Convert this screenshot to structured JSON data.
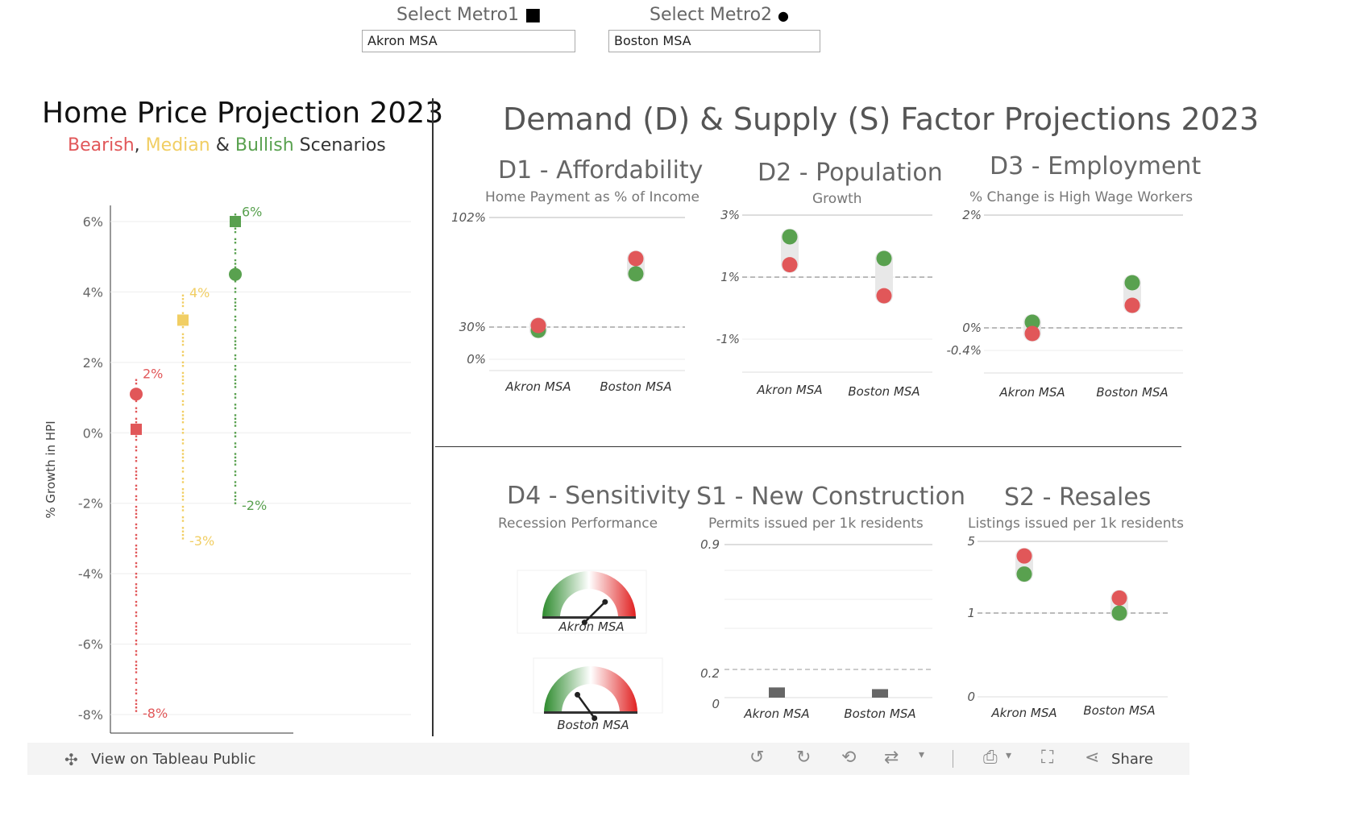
{
  "filters": {
    "metro1": {
      "label": "Select Metro1",
      "symbol": "■",
      "value": "Akron MSA"
    },
    "metro2": {
      "label": "Select Metro2",
      "symbol": "●",
      "value": "Boston MSA"
    }
  },
  "left": {
    "title": "Home Price Projection 2023",
    "subtitle": {
      "bearish": "Bearish",
      "comma": ",",
      "median": "Median",
      "amp": "&",
      "bullish": "Bullish",
      "rest": "Scenarios"
    }
  },
  "right": {
    "title": "Demand (D) & Supply (S) Factor Projections 2023"
  },
  "colors": {
    "red": "#e15759",
    "yellow": "#f1ce63",
    "green": "#59a14f",
    "grey": "#666666"
  },
  "chart_data": [
    {
      "id": "hpi",
      "type": "scatter",
      "title": "Home Price Projection 2023",
      "ylabel": "% Growth in HPI",
      "ylim": [
        -8.5,
        6.3
      ],
      "yticks": [
        "6%",
        "4%",
        "2%",
        "0%",
        "-2%",
        "-4%",
        "-6%",
        "-8%"
      ],
      "ytick_values": [
        6,
        4,
        2,
        0,
        -2,
        -4,
        -6,
        -8
      ],
      "series": [
        {
          "name": "Bearish",
          "color": "#e15759",
          "range": [
            -8,
            1.6
          ],
          "range_labels": [
            "2%",
            "-8%"
          ],
          "metro1_square": 0.1,
          "metro2_circle": 1.1
        },
        {
          "name": "Median",
          "color": "#f1ce63",
          "range": [
            -3.1,
            3.9
          ],
          "range_labels": [
            "4%",
            "-3%"
          ],
          "metro1_square": 3.2,
          "metro2_circle": null
        },
        {
          "name": "Bullish",
          "color": "#59a14f",
          "range": [
            -2.1,
            6.2
          ],
          "range_labels": [
            "6%",
            "-2%"
          ],
          "metro1_square": 6.0,
          "metro2_circle": 4.5
        }
      ]
    },
    {
      "id": "d1",
      "type": "scatter",
      "title": "D1 - Affordability",
      "subtitle": "Home Payment as % of Income",
      "yticks": [
        "102%",
        "30%",
        "0%"
      ],
      "ytick_values": [
        102,
        30,
        0
      ],
      "ylim": [
        0,
        102
      ],
      "reference": 30,
      "categories": [
        "Akron MSA",
        "Boston MSA"
      ],
      "values": [
        {
          "red": 31,
          "green": 27
        },
        {
          "red": 75,
          "green": 65
        }
      ]
    },
    {
      "id": "d2",
      "type": "scatter",
      "title": "D2 - Population",
      "subtitle": "Growth",
      "yticks": [
        "3%",
        "1%",
        "-1%"
      ],
      "ytick_values": [
        3,
        1,
        -1
      ],
      "ylim": [
        -1.2,
        3
      ],
      "reference": 1,
      "categories": [
        "Akron MSA",
        "Boston MSA"
      ],
      "values": [
        {
          "red": 1.4,
          "green": 2.3
        },
        {
          "red": 0.4,
          "green": 1.6
        }
      ]
    },
    {
      "id": "d3",
      "type": "scatter",
      "title": "D3 - Employment",
      "subtitle": "% Change is High Wage Workers",
      "yticks": [
        "2%",
        "0%",
        "-0.4%"
      ],
      "ytick_values": [
        2,
        0,
        -0.4
      ],
      "ylim": [
        -0.4,
        2
      ],
      "reference": 0,
      "categories": [
        "Akron MSA",
        "Boston MSA"
      ],
      "values": [
        {
          "red": -0.1,
          "green": 0.1
        },
        {
          "red": 0.4,
          "green": 0.8
        }
      ]
    },
    {
      "id": "d4",
      "type": "gauge",
      "title": "D4 - Sensitivity",
      "subtitle": "Recession Performance",
      "categories": [
        "Akron MSA",
        "Boston MSA"
      ],
      "values": [
        0.75,
        0.3
      ]
    },
    {
      "id": "s1",
      "type": "bar",
      "title": "S1  - New Construction",
      "subtitle": "Permits issued per 1k residents",
      "yticks": [
        "0.9",
        "0.2",
        "0"
      ],
      "ytick_values": [
        0.9,
        0.2,
        0
      ],
      "ylim": [
        0,
        0.9
      ],
      "reference": 0.2,
      "categories": [
        "Akron MSA",
        "Boston MSA"
      ],
      "values": [
        0.06,
        0.05
      ]
    },
    {
      "id": "s2",
      "type": "scatter",
      "title": "S2  - Resales",
      "subtitle": "Listings issued per 1k residents",
      "yticks": [
        "5",
        "1",
        "0"
      ],
      "ytick_values": [
        5,
        1,
        0
      ],
      "scale": "log",
      "reference": 1,
      "categories": [
        "Akron MSA",
        "Boston MSA"
      ],
      "values": [
        {
          "red": 3.6,
          "green": 2.4
        },
        {
          "red": 1.4,
          "green": 1.0
        }
      ]
    }
  ],
  "toolbar": {
    "view_label": "View on Tableau Public",
    "share_label": "Share"
  }
}
